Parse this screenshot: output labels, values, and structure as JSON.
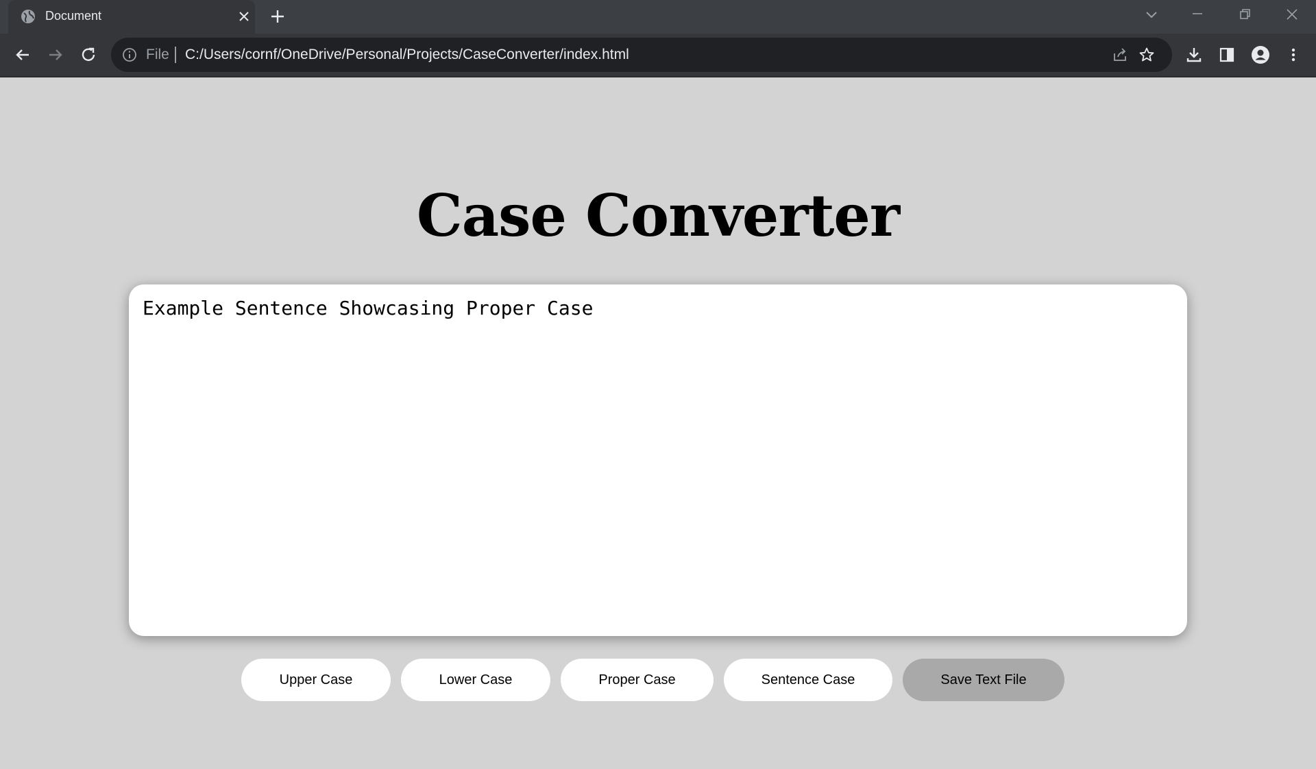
{
  "browser": {
    "tab_title": "Document",
    "address_scheme": "File",
    "address_url": "C:/Users/cornf/OneDrive/Personal/Projects/CaseConverter/index.html",
    "icons": [
      "globe-icon",
      "close-icon",
      "plus-icon",
      "chevron-down-icon",
      "minimize-icon",
      "restore-icon",
      "close-window-icon",
      "back-arrow-icon",
      "forward-arrow-icon",
      "reload-icon",
      "info-icon",
      "share-icon",
      "star-icon",
      "download-icon",
      "sidepanel-icon",
      "profile-icon",
      "more-vert-icon"
    ],
    "colors": {
      "chrome_dark": "#35363a",
      "titlebar": "#3c3f43",
      "omnibox": "#202124"
    }
  },
  "page": {
    "title": "Case Converter",
    "background": "#d3d3d3",
    "textarea_value": "Example Sentence Showcasing Proper Case",
    "buttons": {
      "upper": "Upper Case",
      "lower": "Lower Case",
      "proper": "Proper Case",
      "sentence": "Sentence Case",
      "save": "Save Text File"
    },
    "colors": {
      "button": "#ffffff",
      "save_button": "#a9a9a9"
    }
  }
}
